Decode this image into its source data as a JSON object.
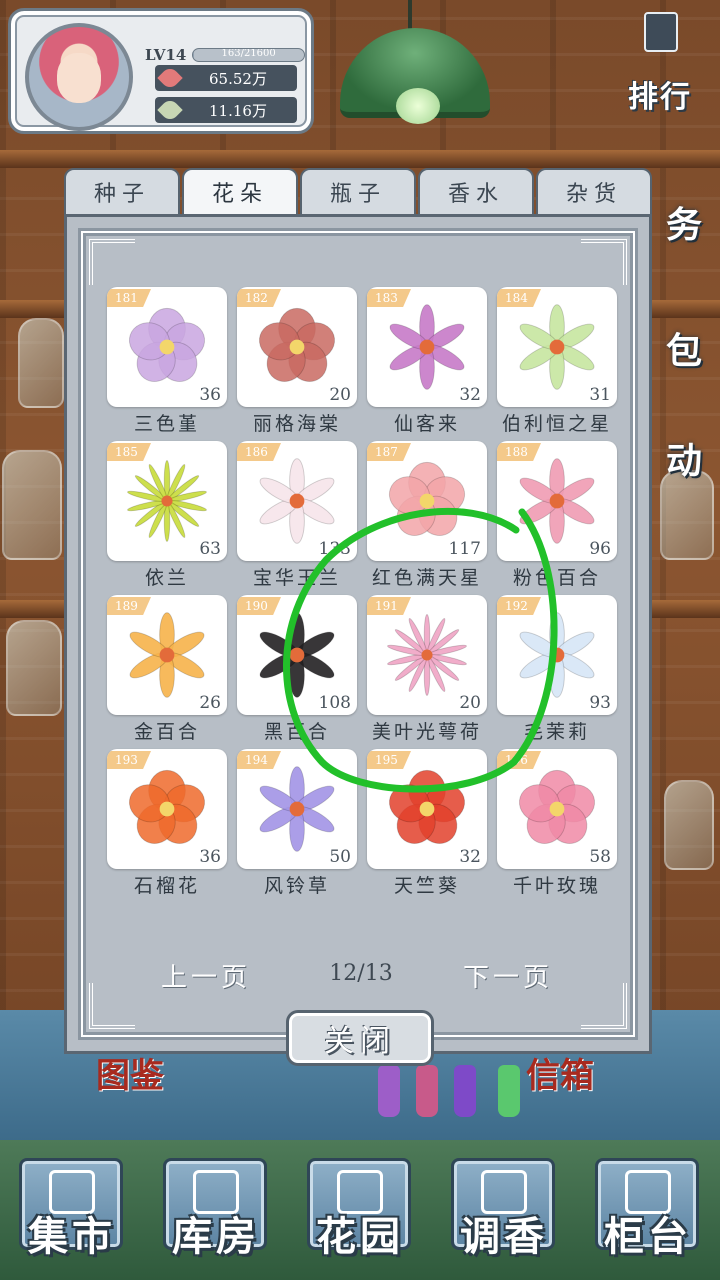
{
  "player": {
    "level": "LV14",
    "xp_text": "163/21600",
    "xp_fraction": 0.01,
    "currency_1": "65.52万",
    "currency_2": "11.16万",
    "currency_1_color": "#e27a7a",
    "currency_2_color": "#5c6a5a"
  },
  "side_buttons": {
    "rank": "排行",
    "task": "务",
    "bag": "包",
    "event": "动"
  },
  "tabs": [
    {
      "label": "种子",
      "active": false
    },
    {
      "label": "花朵",
      "active": true
    },
    {
      "label": "瓶子",
      "active": false
    },
    {
      "label": "香水",
      "active": false
    },
    {
      "label": "杂货",
      "active": false
    }
  ],
  "items": [
    {
      "no": "181",
      "name": "三色堇",
      "qty": "36",
      "color": "#c9a6e0",
      "icon": "pansy-icon"
    },
    {
      "no": "182",
      "name": "丽格海棠",
      "qty": "20",
      "color": "#c96a62",
      "icon": "begonia-icon"
    },
    {
      "no": "183",
      "name": "仙客来",
      "qty": "32",
      "color": "#c77ac8",
      "icon": "cyclamen-icon"
    },
    {
      "no": "184",
      "name": "伯利恒之星",
      "qty": "31",
      "color": "#c6e6a0",
      "icon": "star-of-bethlehem-icon"
    },
    {
      "no": "185",
      "name": "依兰",
      "qty": "63",
      "color": "#c8dc3a",
      "icon": "ylang-ylang-icon"
    },
    {
      "no": "186",
      "name": "宝华玉兰",
      "qty": "133",
      "color": "#f6e4ea",
      "icon": "magnolia-icon"
    },
    {
      "no": "187",
      "name": "红色满天星",
      "qty": "117",
      "color": "#f2a5a8",
      "icon": "red-gypsophila-icon"
    },
    {
      "no": "188",
      "name": "粉色百合",
      "qty": "96",
      "color": "#ef9bb2",
      "icon": "pink-lily-icon"
    },
    {
      "no": "189",
      "name": "金百合",
      "qty": "26",
      "color": "#f6b24a",
      "icon": "golden-lily-icon"
    },
    {
      "no": "190",
      "name": "黑百合",
      "qty": "108",
      "color": "#222022",
      "icon": "black-lily-icon"
    },
    {
      "no": "191",
      "name": "美叶光萼荷",
      "qty": "20",
      "color": "#f0a4c4",
      "icon": "aechmea-icon"
    },
    {
      "no": "192",
      "name": "毛茉莉",
      "qty": "93",
      "color": "#d6e6f6",
      "icon": "jasmine-icon"
    },
    {
      "no": "193",
      "name": "石榴花",
      "qty": "36",
      "color": "#ee6a2c",
      "icon": "pomegranate-flower-icon"
    },
    {
      "no": "194",
      "name": "风铃草",
      "qty": "50",
      "color": "#a293e6",
      "icon": "bellflower-icon"
    },
    {
      "no": "195",
      "name": "天竺葵",
      "qty": "32",
      "color": "#e2412c",
      "icon": "geranium-icon"
    },
    {
      "no": "196",
      "name": "千叶玫瑰",
      "qty": "58",
      "color": "#f08aa6",
      "icon": "rose-icon"
    }
  ],
  "pager": {
    "prev": "上一页",
    "count": "12/13",
    "next": "下一页"
  },
  "close_label": "关闭",
  "behind_labels": {
    "left": "图鉴",
    "right": "信箱"
  },
  "bottom_nav": [
    {
      "label": "集市",
      "icon": "market-gate-icon"
    },
    {
      "label": "库房",
      "icon": "warehouse-icon"
    },
    {
      "label": "花园",
      "icon": "garden-rose-icon"
    },
    {
      "label": "调香",
      "icon": "perfume-mixing-icon"
    },
    {
      "label": "柜台",
      "icon": "counter-icon"
    }
  ],
  "annotation_color": "#22c02a"
}
